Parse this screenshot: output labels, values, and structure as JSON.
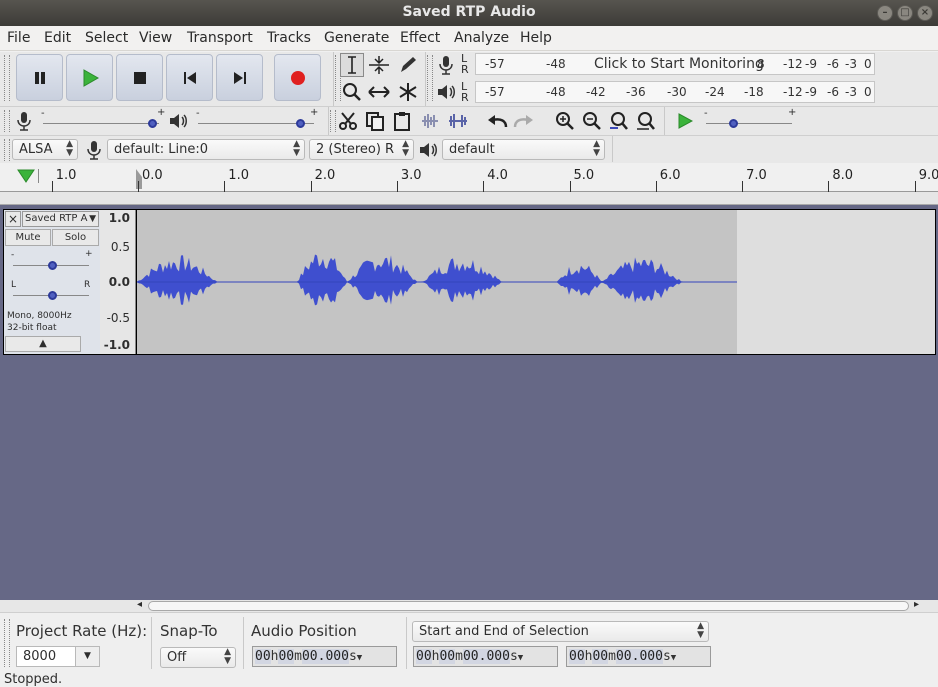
{
  "window": {
    "title": "Saved RTP Audio"
  },
  "menu": [
    "File",
    "Edit",
    "Select",
    "View",
    "Transport",
    "Tracks",
    "Generate",
    "Effect",
    "Analyze",
    "Help"
  ],
  "transport": {
    "pause": "pause",
    "play": "play",
    "stop": "stop",
    "skip_start": "skip-to-start",
    "skip_end": "skip-to-end",
    "record": "record"
  },
  "meters": {
    "record_scale": [
      "-57",
      "-48",
      "",
      "",
      "",
      "",
      "",
      "-12",
      "-9",
      "-6",
      "-3",
      "0"
    ],
    "record_text": "Click to Start Monitoring",
    "record_after": "8",
    "play_scale": [
      "-57",
      "-48",
      "-42",
      "-36",
      "-30",
      "-24",
      "-18",
      "-12",
      "-9",
      "-6",
      "-3",
      "0"
    ],
    "channel_l": "L",
    "channel_r": "R"
  },
  "device": {
    "host": "ALSA",
    "recording_device": "default: Line:0",
    "channels": "2 (Stereo) R",
    "playback_device": "default"
  },
  "ruler": {
    "ticks": [
      "1.0",
      "0.0",
      "1.0",
      "2.0",
      "3.0",
      "4.0",
      "5.0",
      "6.0",
      "7.0",
      "8.0",
      "9.0"
    ]
  },
  "track": {
    "name": "Saved RTP A",
    "mute": "Mute",
    "solo": "Solo",
    "pan_l": "L",
    "pan_r": "R",
    "gain_minus": "-",
    "gain_plus": "+",
    "info1": "Mono, 8000Hz",
    "info2": "32-bit float",
    "vruler": [
      "1.0",
      "0.5",
      "0.0",
      "-0.5",
      "-1.0"
    ]
  },
  "selection_bar": {
    "project_rate_label": "Project Rate (Hz):",
    "project_rate": "8000",
    "snap_to_label": "Snap-To",
    "snap_to": "Off",
    "audio_position_label": "Audio Position",
    "selection_mode": "Start and End of Selection",
    "time_h": "00",
    "time_m": "00",
    "time_s": "00.000",
    "u_h": "h",
    "u_m": "m",
    "u_s": "s"
  },
  "status": "Stopped.",
  "colors": {
    "waveform": "#3f4fcf",
    "clip": "#c4c4c4",
    "track_bg": "#666886",
    "record": "#e02020",
    "play": "#3bb33b"
  }
}
